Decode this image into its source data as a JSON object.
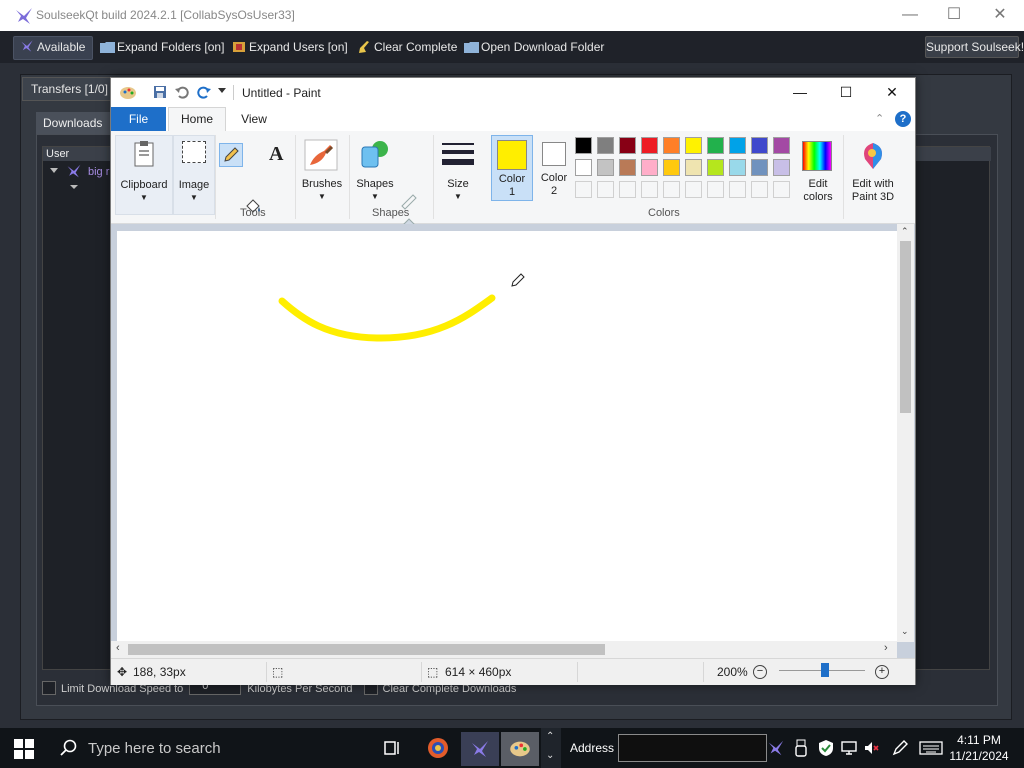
{
  "soulseek": {
    "title": "SoulseekQt build 2024.2.1 [CollabSysOsUser33]",
    "toolbar": {
      "available": "Available",
      "expand_folders": "Expand Folders [on]",
      "expand_users": "Expand Users [on]",
      "clear_complete": "Clear Complete",
      "open_download_folder": "Open Download Folder",
      "support": "Support Soulseek!"
    },
    "transfers_tab": "Transfers [1/0]",
    "downloads_tab": "Downloads",
    "tree_header_user": "User",
    "tree_user": "big r",
    "footer": {
      "limit_speed": "Limit Download Speed to",
      "speed_value": "0",
      "units": "Kilobytes Per Second",
      "clear_complete_downloads": "Clear Complete Downloads"
    }
  },
  "paint": {
    "title": "Untitled - Paint",
    "tabs": {
      "file": "File",
      "home": "Home",
      "view": "View"
    },
    "help": "?",
    "ribbon": {
      "clipboard": "Clipboard",
      "image": "Image",
      "tools_group": "Tools",
      "brushes": "Brushes",
      "shapes": "Shapes",
      "shapes_group": "Shapes",
      "size": "Size",
      "color1_a": "Color",
      "color1_b": "1",
      "color2_a": "Color",
      "color2_b": "2",
      "colors_group": "Colors",
      "edit_colors_a": "Edit",
      "edit_colors_b": "colors",
      "paint3d_a": "Edit with",
      "paint3d_b": "Paint 3D"
    },
    "colors": {
      "color1": "#ffee00",
      "color2": "#ffffff",
      "palette_row1": [
        "#000000",
        "#7f7f7f",
        "#880015",
        "#ed1c24",
        "#ff7f27",
        "#fff200",
        "#22b14c",
        "#00a2e8",
        "#3f48cc",
        "#a349a4"
      ],
      "palette_row2": [
        "#ffffff",
        "#c3c3c3",
        "#b97a57",
        "#ffaec9",
        "#ffc90e",
        "#efe4b0",
        "#b5e61d",
        "#99d9ea",
        "#7092be",
        "#c8bfe7"
      ],
      "stroke": "#ffee00"
    },
    "status": {
      "cursor_pos": "188, 33px",
      "canvas_size": "614 × 460px",
      "zoom": "200%"
    }
  },
  "taskbar": {
    "search_placeholder": "Type here to search",
    "address_label": "Address",
    "time": "4:11 PM",
    "date": "11/21/2024"
  }
}
